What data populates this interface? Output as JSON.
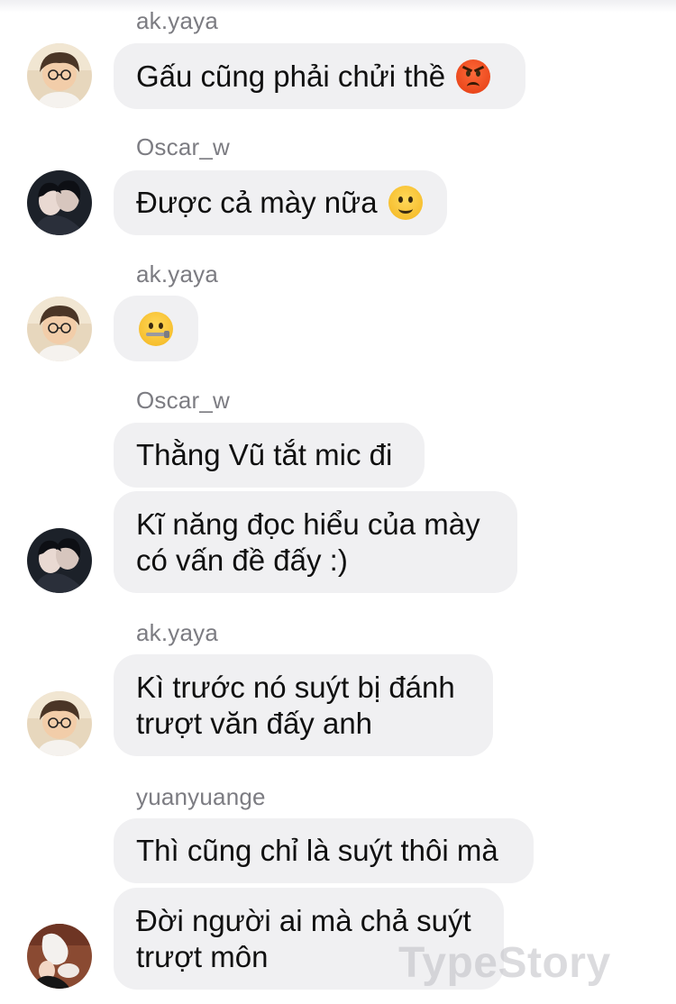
{
  "messages": [
    {
      "sender": "ak.yaya",
      "lines": [
        "Gấu cũng phải chửi thề"
      ],
      "emoji": "pouting-face-emoji"
    },
    {
      "sender": "Oscar_w",
      "lines": [
        "Được cả mày nữa"
      ],
      "emoji": "slightly-smiling-face-emoji"
    },
    {
      "sender": "ak.yaya",
      "lines": [],
      "emoji": "zipper-mouth-face-emoji"
    },
    {
      "sender": "Oscar_w",
      "lines": [
        "Thằng Vũ tắt mic đi"
      ]
    },
    {
      "sender": "Oscar_w",
      "lines": [
        "Kĩ năng đọc hiểu của mày",
        "có vấn đề đấy :)"
      ]
    },
    {
      "sender": "ak.yaya",
      "lines": [
        "Kì trước nó suýt bị đánh",
        "trượt văn đấy anh"
      ]
    },
    {
      "sender": "yuanyuange",
      "lines": [
        "Thì cũng chỉ là suýt thôi mà"
      ]
    },
    {
      "sender": "yuanyuange",
      "lines": [
        "Đời người ai mà chả suýt",
        "trượt môn"
      ]
    }
  ],
  "watermark": "TypeStory"
}
